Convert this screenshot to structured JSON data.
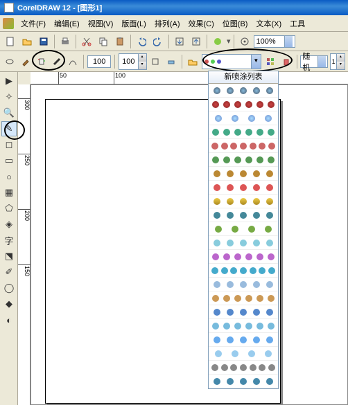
{
  "title": "CorelDRAW 12 - [图形1]",
  "menu": {
    "file": "文件(F)",
    "edit": "编辑(E)",
    "view": "视图(V)",
    "layout": "版面(L)",
    "arrange": "排列(A)",
    "effects": "效果(C)",
    "bitmap": "位图(B)",
    "text": "文本(X)",
    "tools": "工具"
  },
  "zoom": "100%",
  "propbar": {
    "size1": "100",
    "size2": "100",
    "mode": "随机"
  },
  "spray": {
    "header": "新喷涂列表"
  },
  "ruler_h": [
    "50",
    "100"
  ],
  "ruler_v": [
    "300",
    "250",
    "200",
    "150"
  ]
}
